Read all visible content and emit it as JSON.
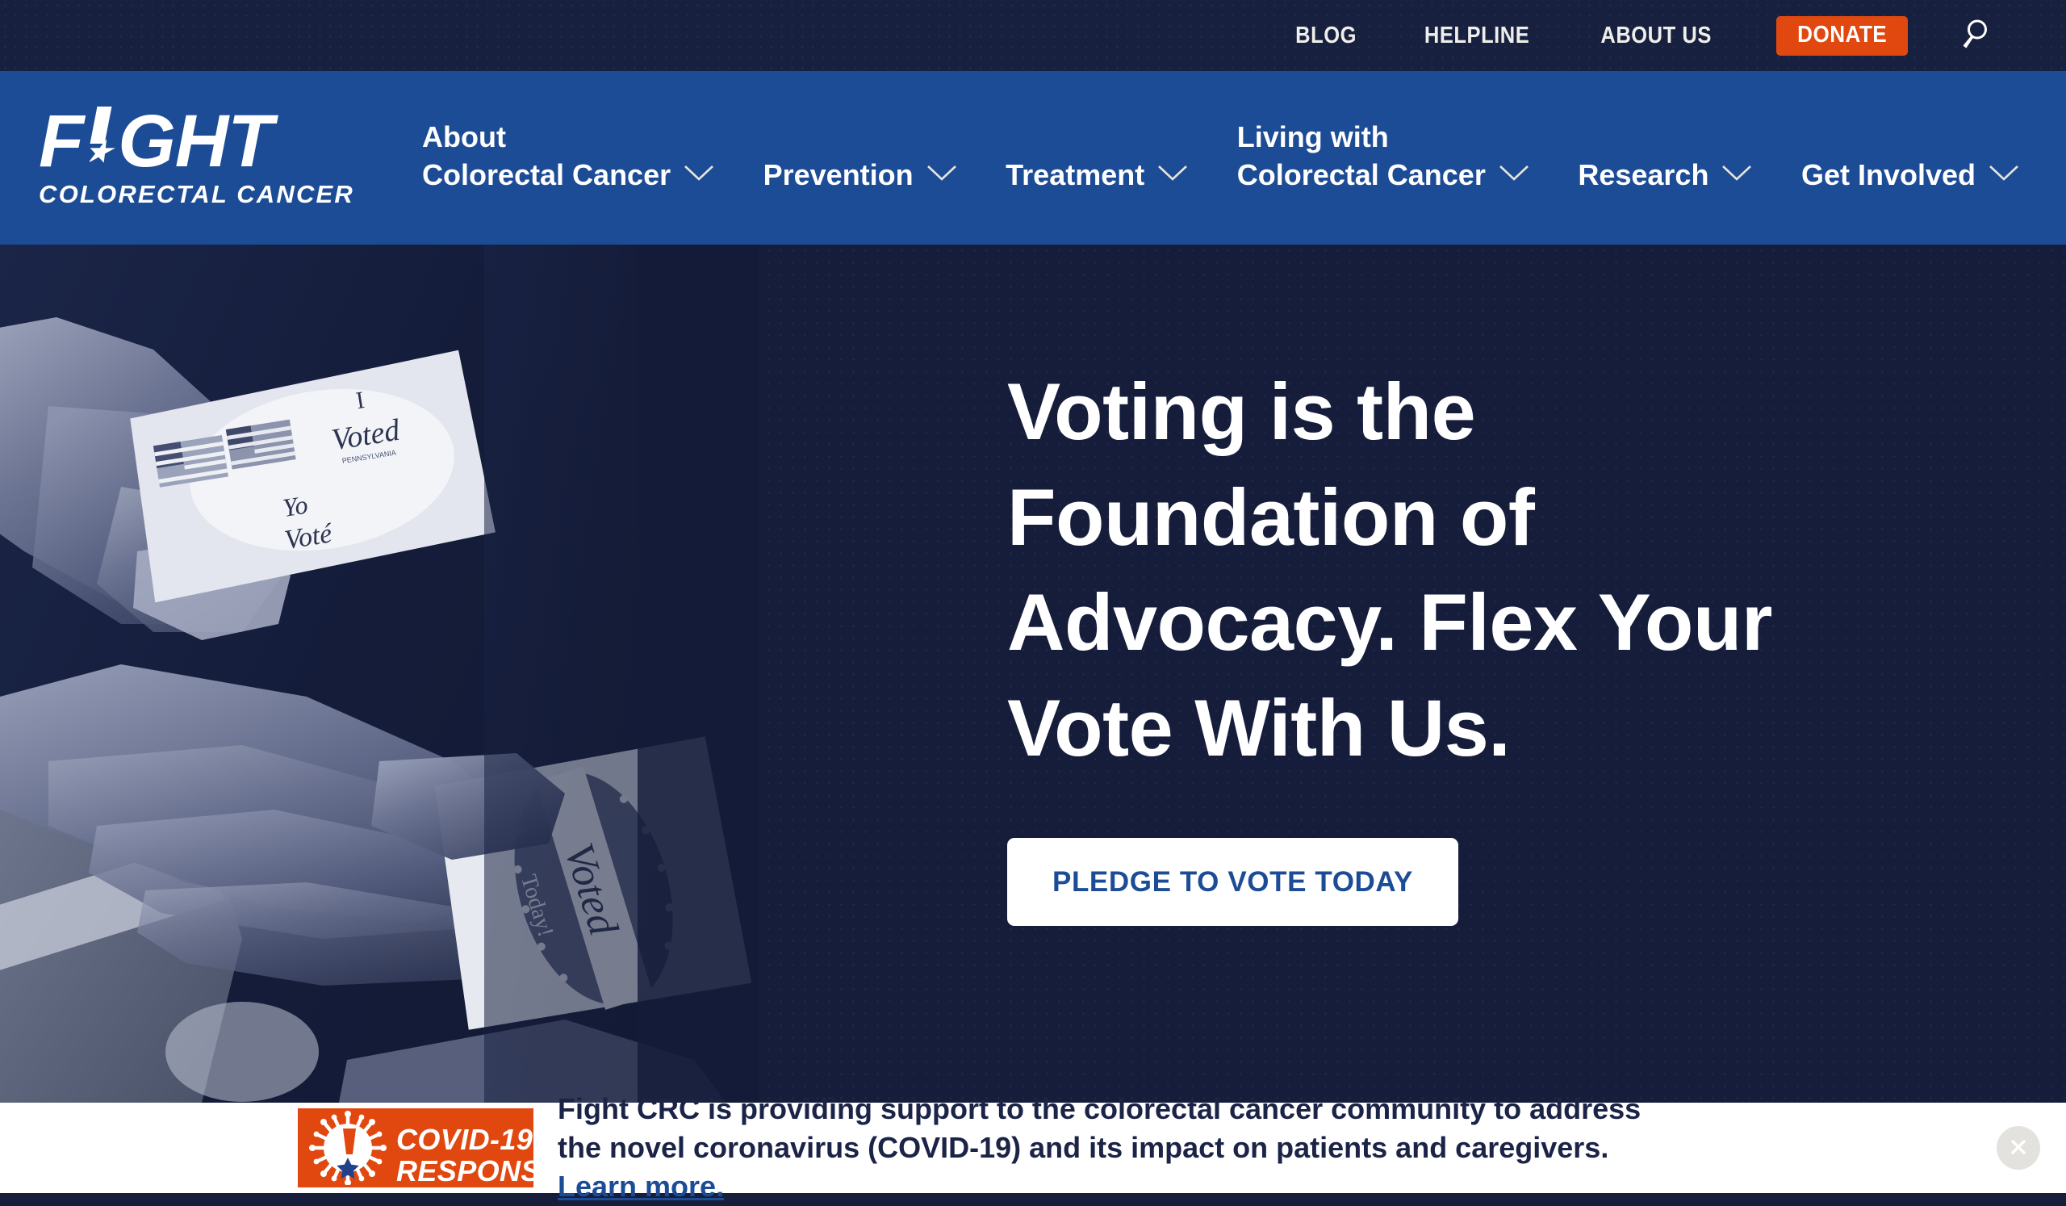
{
  "topbar": {
    "links": [
      {
        "label": "BLOG",
        "name": "blog"
      },
      {
        "label": "HELPLINE",
        "name": "helpline"
      },
      {
        "label": "ABOUT US",
        "name": "about-us"
      }
    ],
    "donate_label": "DONATE",
    "donate_color": "#E1480F",
    "search_icon": "search-icon",
    "bg_color": "#17203F"
  },
  "logo": {
    "word_part1": "F",
    "word_part2": "GHT",
    "exclamation_star": "★",
    "subtitle": "COLORECTAL CANCER",
    "bg_color": "#1D4C96"
  },
  "nav": {
    "items": [
      {
        "line1": "About",
        "line2": "Colorectal Cancer",
        "has_chevron": true
      },
      {
        "line1": "",
        "line2": "Prevention",
        "has_chevron": true
      },
      {
        "line1": "",
        "line2": "Treatment",
        "has_chevron": true
      },
      {
        "line1": "Living with",
        "line2": "Colorectal Cancer",
        "has_chevron": true
      },
      {
        "line1": "",
        "line2": "Research",
        "has_chevron": true
      },
      {
        "line1": "",
        "line2": "Get Involved",
        "has_chevron": true
      }
    ],
    "chevron_icon": "chevron-down-icon"
  },
  "hero": {
    "title_line1": "Voting is the",
    "title_line2": "Foundation of",
    "title_line3": "Advocacy. Flex Your",
    "title_line4": "Vote With Us.",
    "cta_label": "PLEDGE TO VOTE TODAY",
    "cta_text_color": "#1D4C96",
    "bg_color": "#151D3B",
    "image_alt": "hands-holding-i-voted-stickers",
    "sticker1_line1": "I",
    "sticker1_line2": "Voted",
    "sticker1_line3": "Yo",
    "sticker1_line4": "Voté",
    "sticker2_line1": "Voted",
    "sticker2_line2": "Today!"
  },
  "banner": {
    "badge_line1": "COVID-19",
    "badge_line2": "RESPONSE",
    "badge_color": "#E1480F",
    "text_part1": "Fight CRC is providing support to the colorectal cancer community to address the novel coronavirus (COVID-19) and its impact on patients and caregivers. ",
    "link_label": "Learn more.",
    "close_icon": "close-icon"
  }
}
